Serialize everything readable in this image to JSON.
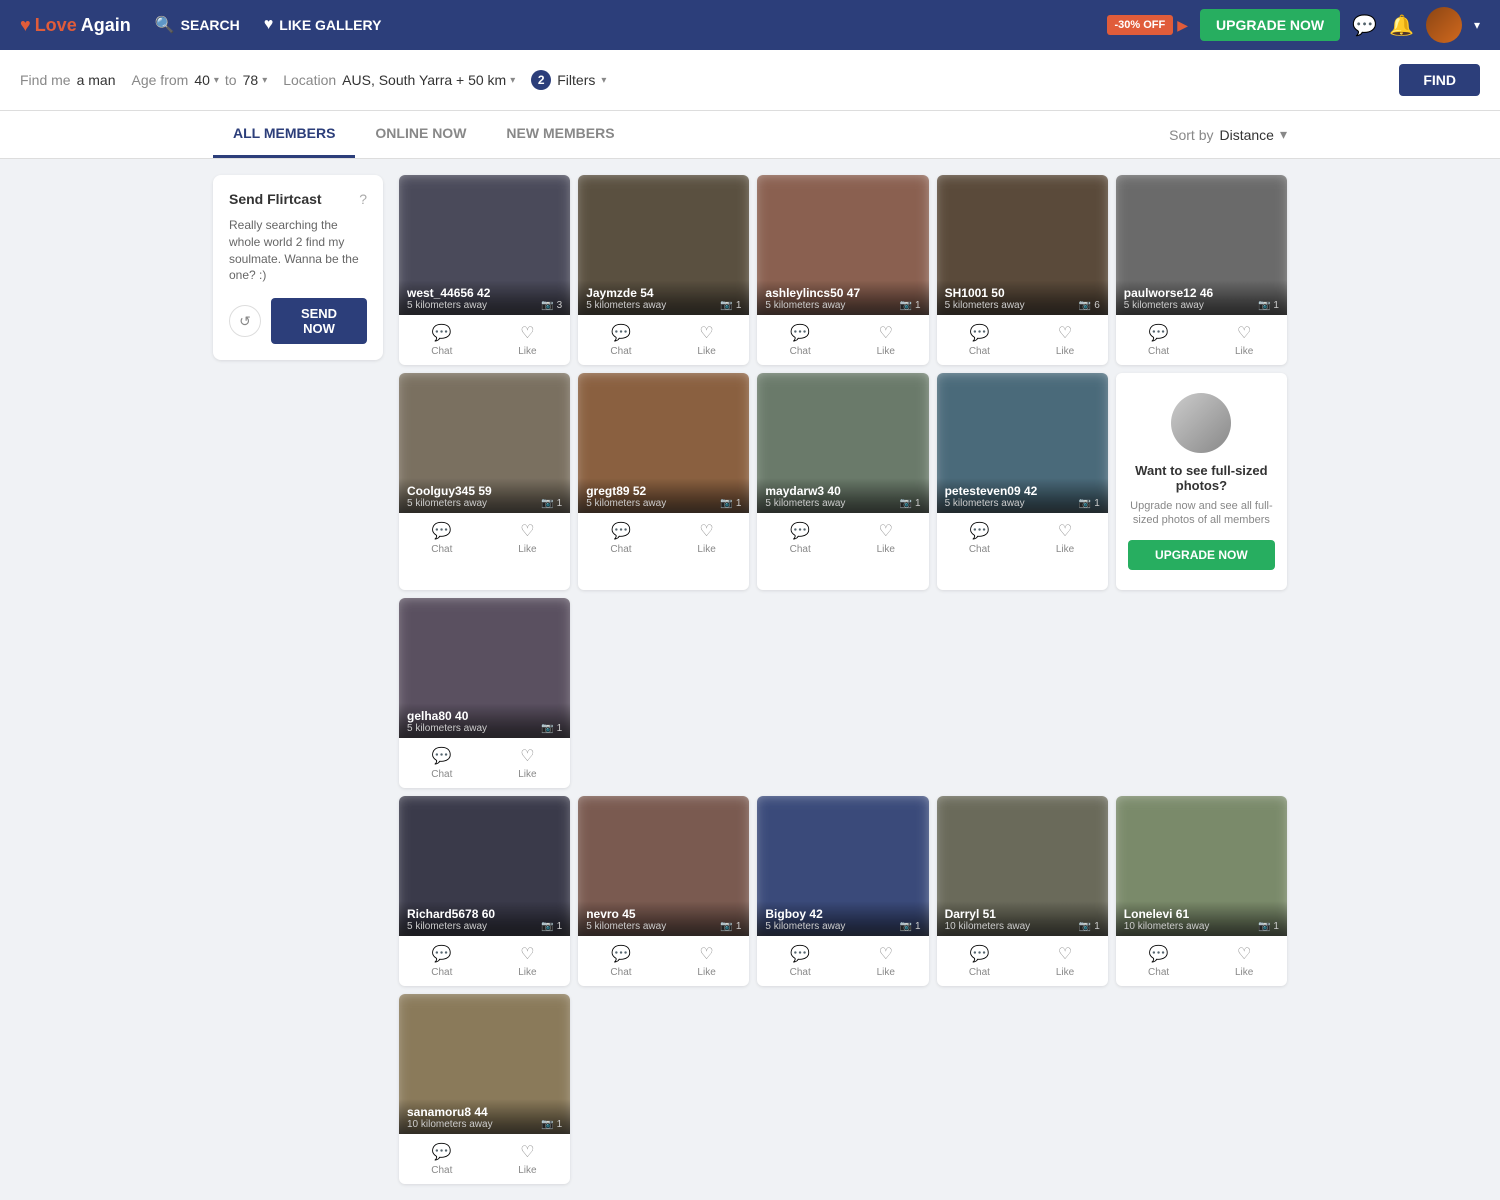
{
  "header": {
    "logo_love": "Love",
    "logo_again": "Again",
    "nav_search": "SEARCH",
    "nav_like_gallery": "LIKE GALLERY",
    "discount": "-30% OFF",
    "discount_arrow": "▶",
    "upgrade_btn": "UPGRADE NOW",
    "messages_icon": "💬",
    "notifications_icon": "🔔"
  },
  "search_bar": {
    "find_me_label": "Find me",
    "find_me_value": "a man",
    "age_from_label": "Age from",
    "age_from_value": "40",
    "age_to_label": "to",
    "age_to_value": "78",
    "location_label": "Location",
    "location_value": "AUS, South Yarra + 50 km",
    "filters_count": "2",
    "filters_label": "Filters",
    "find_btn": "FIND"
  },
  "tabs": {
    "all_members": "ALL MEMBERS",
    "online_now": "ONLINE NOW",
    "new_members": "NEW MEMBERS",
    "sort_label": "Sort by",
    "sort_value": "Distance"
  },
  "flirtcast": {
    "title": "Send Flirtcast",
    "help": "?",
    "text": "Really searching the whole world 2 find my soulmate. Wanna be the one? :)",
    "refresh_icon": "↺",
    "send_btn": "SEND NOW"
  },
  "members_row1": [
    {
      "username": "west_44656",
      "age": "42",
      "distance": "5 kilometers away",
      "photos": "3",
      "bg": "#4a4a5a",
      "chat_label": "Chat",
      "like_label": "Like"
    },
    {
      "username": "Jaymzde",
      "age": "54",
      "distance": "5 kilometers away",
      "photos": "1",
      "bg": "#5a5040",
      "chat_label": "Chat",
      "like_label": "Like"
    },
    {
      "username": "ashleylincs50",
      "age": "47",
      "distance": "5 kilometers away",
      "photos": "1",
      "bg": "#8a6050",
      "chat_label": "Chat",
      "like_label": "Like"
    },
    {
      "username": "SH1001",
      "age": "50",
      "distance": "5 kilometers away",
      "photos": "6",
      "bg": "#5a4a3a",
      "chat_label": "Chat",
      "like_label": "Like"
    },
    {
      "username": "paulworse12",
      "age": "46",
      "distance": "5 kilometers away",
      "photos": "1",
      "bg": "#6a6a6a",
      "chat_label": "Chat",
      "like_label": "Like"
    }
  ],
  "members_row2": [
    {
      "username": "Coolguy345",
      "age": "59",
      "distance": "5 kilometers away",
      "photos": "1",
      "bg": "#7a7060",
      "chat_label": "Chat",
      "like_label": "Like"
    },
    {
      "username": "gregt89",
      "age": "52",
      "distance": "5 kilometers away",
      "photos": "1",
      "bg": "#8a6040",
      "chat_label": "Chat",
      "like_label": "Like"
    },
    {
      "username": "maydarw3",
      "age": "40",
      "distance": "5 kilometers away",
      "photos": "1",
      "bg": "#6a7a6a",
      "chat_label": "Chat",
      "like_label": "Like"
    },
    {
      "username": "petesteven09",
      "age": "42",
      "distance": "5 kilometers away",
      "photos": "1",
      "bg": "#4a6a7a",
      "chat_label": "Chat",
      "like_label": "Like"
    }
  ],
  "upgrade_promo": {
    "title": "Want to see full-sized photos?",
    "text": "Upgrade now and see all full-sized photos of all members",
    "btn": "UPGRADE NOW"
  },
  "upgrade_promo_extra": {
    "username": "gelha80",
    "age": "40",
    "distance": "5 kilometers away",
    "photos": "1",
    "bg": "#5a5060",
    "chat_label": "Chat",
    "like_label": "Like"
  },
  "members_row3": [
    {
      "username": "Richard5678",
      "age": "60",
      "distance": "5 kilometers away",
      "photos": "1",
      "bg": "#3a3a4a",
      "chat_label": "Chat",
      "like_label": "Like"
    },
    {
      "username": "nevro",
      "age": "45",
      "distance": "5 kilometers away",
      "photos": "1",
      "bg": "#7a5a50",
      "chat_label": "Chat",
      "like_label": "Like"
    },
    {
      "username": "Bigboy",
      "age": "42",
      "distance": "5 kilometers away",
      "photos": "1",
      "bg": "#3a4a7a",
      "chat_label": "Chat",
      "like_label": "Like"
    },
    {
      "username": "Darryl",
      "age": "51",
      "distance": "10 kilometers away",
      "photos": "1",
      "bg": "#6a6a5a",
      "chat_label": "Chat",
      "like_label": "Like"
    },
    {
      "username": "Lonelevi",
      "age": "61",
      "distance": "10 kilometers away",
      "photos": "1",
      "bg": "#7a8a6a",
      "chat_label": "Chat",
      "like_label": "Like"
    },
    {
      "username": "sanamoru8",
      "age": "44",
      "distance": "10 kilometers away",
      "photos": "1",
      "bg": "#8a7a5a",
      "chat_label": "Chat",
      "like_label": "Like"
    }
  ]
}
